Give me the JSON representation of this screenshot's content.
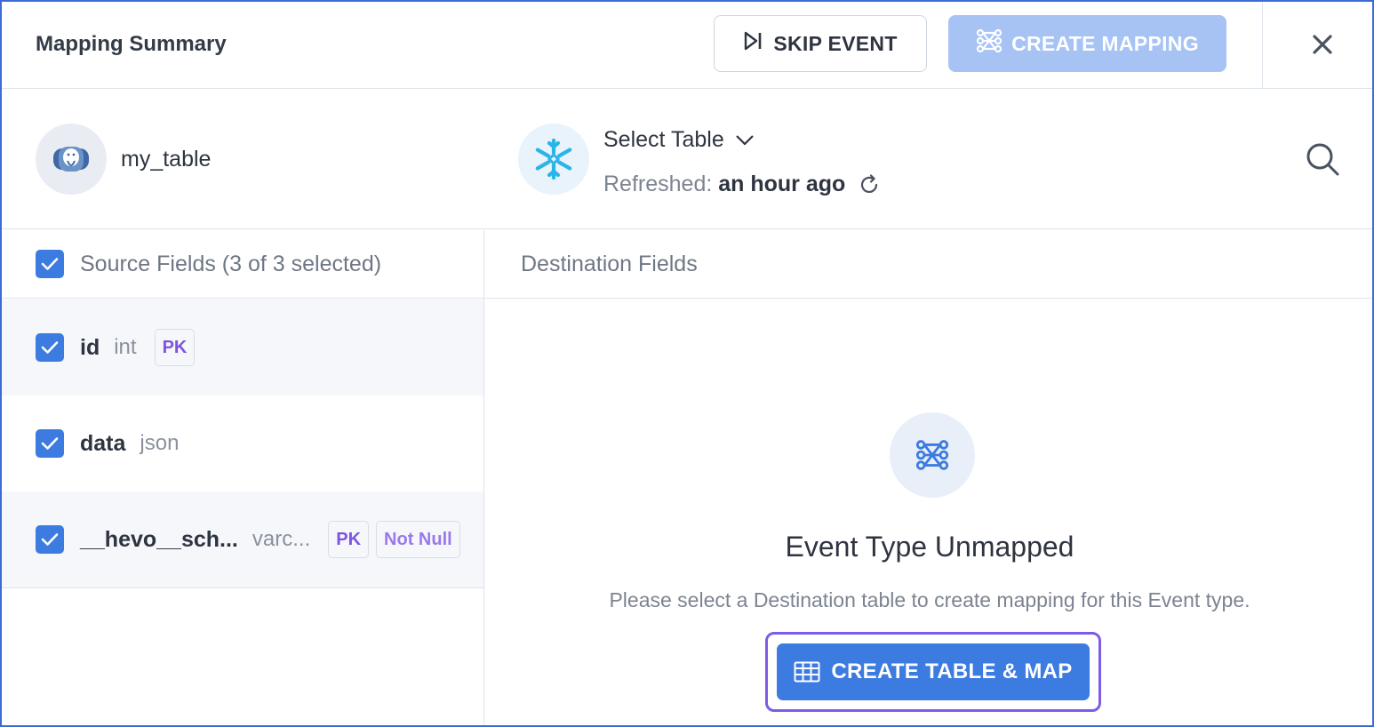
{
  "header": {
    "title": "Mapping Summary",
    "skip_label": "SKIP EVENT",
    "create_mapping_label": "CREATE MAPPING"
  },
  "source": {
    "table_name": "my_table",
    "icon": "postgres-elephant-icon"
  },
  "destination": {
    "icon": "snowflake-icon",
    "select_label": "Select Table",
    "refreshed_label": "Refreshed:",
    "refreshed_value": "an hour ago"
  },
  "columns": {
    "source_header": "Source Fields (3 of 3 selected)",
    "destination_header": "Destination Fields"
  },
  "fields": [
    {
      "name": "id",
      "type": "int",
      "badges": [
        "PK"
      ]
    },
    {
      "name": "data",
      "type": "json",
      "badges": []
    },
    {
      "name": "__hevo__sch...",
      "type": "varc...",
      "badges": [
        "PK",
        "Not Null"
      ]
    }
  ],
  "empty_state": {
    "title": "Event Type Unmapped",
    "description": "Please select a Destination table to create mapping for this Event type.",
    "button_label": "CREATE TABLE & MAP"
  },
  "colors": {
    "primary": "#3c7be0",
    "primary_disabled": "#a6c3f4",
    "focus_ring": "#7c5ce6",
    "badge_text": "#7b55e0",
    "snowflake": "#29b5e8"
  }
}
